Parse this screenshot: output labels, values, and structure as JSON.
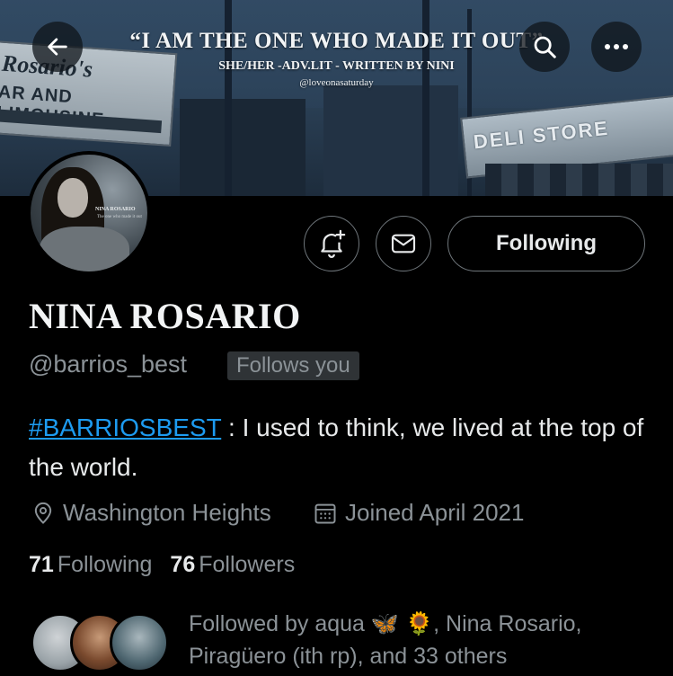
{
  "banner": {
    "title": "“I AM THE ONE WHO MADE IT OUT”",
    "subtitle": "SHE/HER -ADV.LIT - WRITTEN BY NINI",
    "credit": "@loveonasaturday",
    "sign_left_top": "Rosario's",
    "sign_left_mid": "AR AND LIMOUSINE",
    "sign_right": "DELI STORE"
  },
  "nav": {
    "back_icon": "arrow-left-icon",
    "search_icon": "search-icon",
    "more_icon": "more-dots-icon"
  },
  "avatar": {
    "caption": "NINA ROSARIO",
    "caption_sub": "The one who made it out"
  },
  "actions": {
    "notify_icon": "bell-plus-icon",
    "message_icon": "envelope-icon",
    "following_label": "Following"
  },
  "profile": {
    "name": "NINA ROSARIO",
    "handle": "@barrios_best",
    "follows_you": "Follows you",
    "bio_hashtag": "#BARRIOSBEST",
    "bio_text": " : I used to think, we lived at the top of the world.",
    "location": "Washington Heights",
    "joined": "Joined April 2021",
    "following_count": "71",
    "following_label": "Following",
    "followers_count": "76",
    "followers_label": "Followers"
  },
  "followed_by": {
    "prefix": "Followed by aqua ",
    "emoji1": "🦋",
    "emoji2": "🌻",
    "rest": ", Nina Rosario, Piragüero (ith rp), and 33 others"
  },
  "colors": {
    "background": "#000000",
    "text_primary": "#e7e9ea",
    "text_secondary": "#8b9297",
    "link": "#1d9bf0",
    "border": "#6f767b"
  }
}
